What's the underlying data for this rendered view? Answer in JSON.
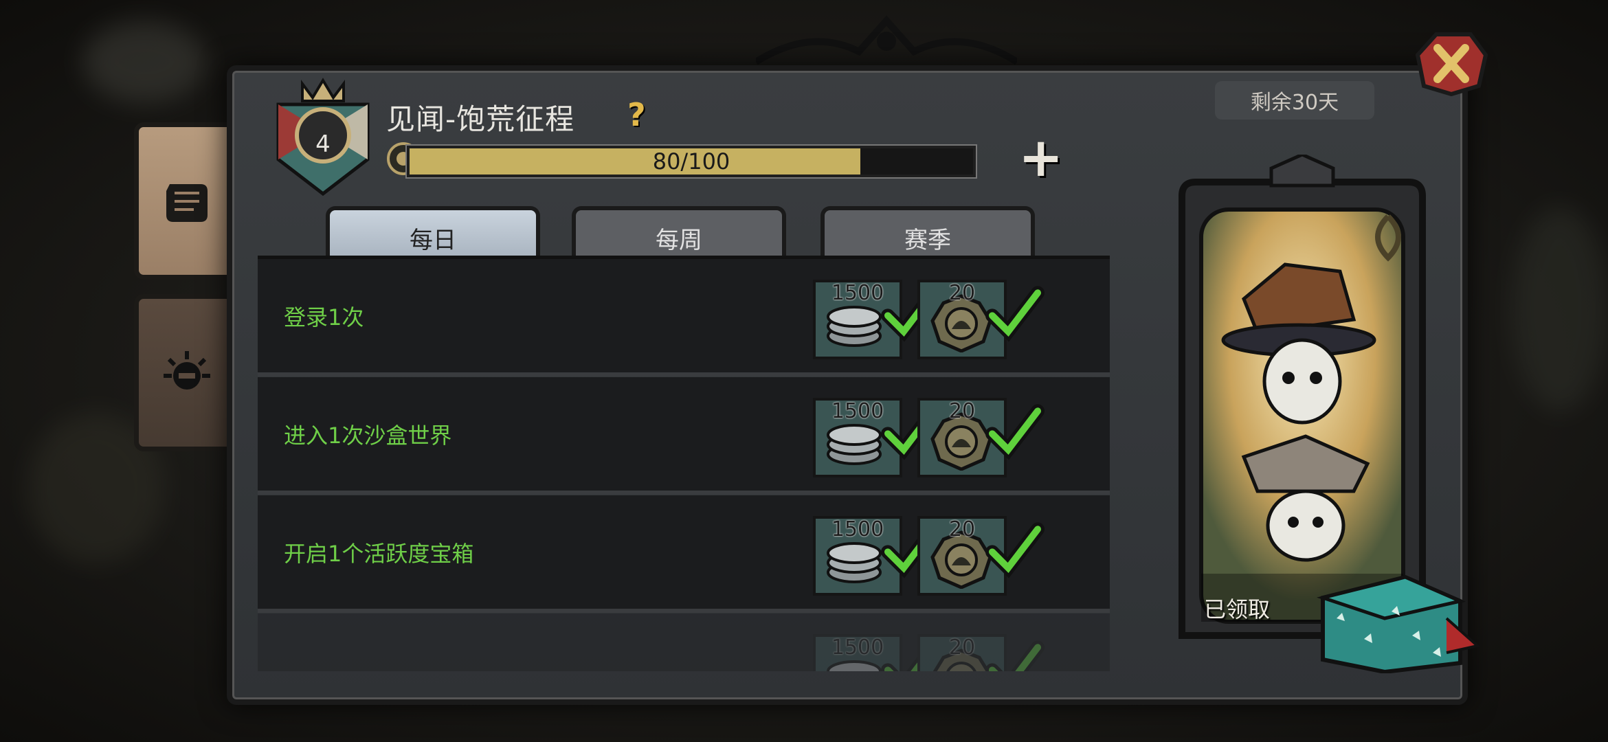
{
  "header": {
    "title": "见闻-饱荒征程",
    "level": "4",
    "remaining": "剩余30天",
    "progress_text": "80/100",
    "progress_fraction": 0.8,
    "plus_label": "+"
  },
  "tabs": [
    {
      "label": "每日",
      "active": true
    },
    {
      "label": "每周",
      "active": false
    },
    {
      "label": "赛季",
      "active": false
    }
  ],
  "tasks": [
    {
      "label": "登录1次",
      "rewards": [
        {
          "amount": "1500",
          "icon": "coin-stack-icon"
        },
        {
          "amount": "20",
          "icon": "medal-icon"
        }
      ]
    },
    {
      "label": "进入1次沙盒世界",
      "rewards": [
        {
          "amount": "1500",
          "icon": "coin-stack-icon"
        },
        {
          "amount": "20",
          "icon": "medal-icon"
        }
      ]
    },
    {
      "label": "开启1个活跃度宝箱",
      "rewards": [
        {
          "amount": "1500",
          "icon": "coin-stack-icon"
        },
        {
          "amount": "20",
          "icon": "medal-icon"
        }
      ]
    },
    {
      "label": "",
      "rewards": [
        {
          "amount": "1500",
          "icon": "coin-stack-icon"
        },
        {
          "amount": "20",
          "icon": "medal-icon"
        }
      ]
    }
  ],
  "card": {
    "status": "已领取"
  },
  "colors": {
    "task_text": "#6fcf48",
    "progress_fill": "#c6b161",
    "check": "#5fd13c"
  }
}
